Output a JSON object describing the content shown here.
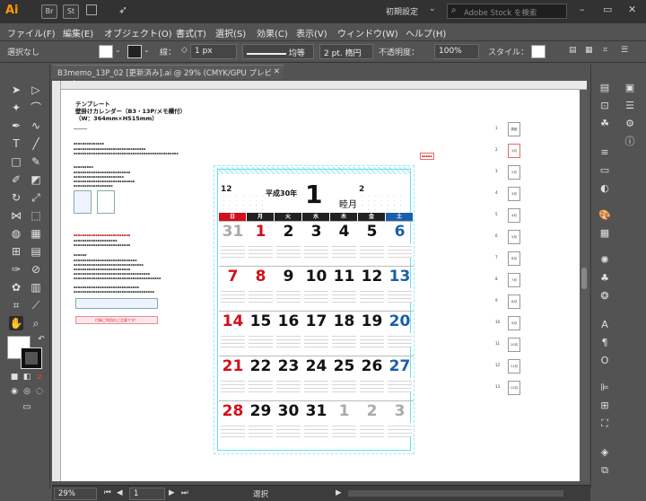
{
  "titlebar": {
    "logo": "Ai",
    "apps": [
      "Br",
      "St"
    ],
    "preset": "初期設定",
    "search_placeholder": "Adobe Stock を検索"
  },
  "menu": [
    "ファイル(F)",
    "編集(E)",
    "オブジェクト(O)",
    "書式(T)",
    "選択(S)",
    "効果(C)",
    "表示(V)",
    "ウィンドウ(W)",
    "ヘルプ(H)"
  ],
  "control": {
    "selection": "選択なし",
    "stroke_label": "線：",
    "stroke_value": "1 px",
    "profile": "均等",
    "brush": "2 pt. 楕円",
    "opacity_label": "不透明度：",
    "opacity_value": "100%",
    "style_label": "スタイル："
  },
  "document": {
    "tab_title": "B3memo_13P_02 [更新済み].ai @ 29% (CMYK/GPU プレビュー)"
  },
  "template": {
    "title_lines": [
      "テンプレート",
      "壁掛けカレンダー（B3・13P/メモ欄付）",
      "（W：364mm×H515mm）"
    ],
    "pink_note": "付録ご利用のご注意です！"
  },
  "calendar": {
    "year": "平成30年",
    "month": "1",
    "month_jp": "睦月",
    "prev_month": "12",
    "next_month": "2",
    "weekdays": [
      "日",
      "月",
      "火",
      "水",
      "木",
      "金",
      "土"
    ],
    "weekday_colors": [
      "#d0101c",
      "#222222",
      "#222222",
      "#222222",
      "#222222",
      "#222222",
      "#1a5fa8"
    ],
    "weeks": [
      [
        "31",
        "1",
        "2",
        "3",
        "4",
        "5",
        "6"
      ],
      [
        "7",
        "8",
        "9",
        "10",
        "11",
        "12",
        "13"
      ],
      [
        "14",
        "15",
        "16",
        "17",
        "18",
        "19",
        "20"
      ],
      [
        "21",
        "22",
        "23",
        "24",
        "25",
        "26",
        "27"
      ],
      [
        "28",
        "29",
        "30",
        "31",
        "1",
        "2",
        "3"
      ]
    ]
  },
  "legend": {
    "items": [
      "表紙",
      "1月",
      "2月",
      "3月",
      "4月",
      "5月",
      "6月",
      "7月",
      "8月",
      "9月",
      "10月",
      "11月",
      "12月"
    ]
  },
  "status": {
    "zoom": "29%",
    "page": "1",
    "mode": "選択"
  }
}
